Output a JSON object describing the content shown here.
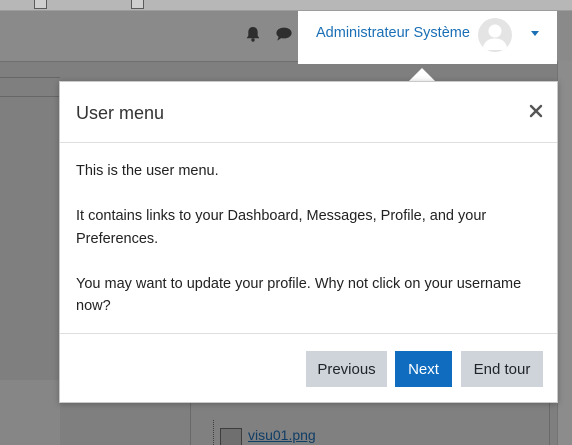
{
  "navbar": {
    "notifications_icon": "bell-icon",
    "messages_icon": "chat-bubble-icon",
    "user_name": "Administrateur Système",
    "avatar_icon": "user-avatar-icon",
    "dropdown_icon": "caret-down-icon"
  },
  "tour": {
    "title": "User menu",
    "close_icon": "close-icon",
    "paragraphs": [
      "This is the user menu.",
      "It contains links to your Dashboard, Messages, Profile, and your Preferences.",
      "You may want to update your profile. Why not click on your username now?"
    ],
    "buttons": {
      "previous": "Previous",
      "next": "Next",
      "end": "End tour"
    }
  },
  "background": {
    "file_name": "visu01.png",
    "file_icon": "image-file-icon"
  },
  "colors": {
    "accent": "#0f6cbf",
    "link": "#1a6fb5",
    "secondary_button": "#ced4da"
  }
}
